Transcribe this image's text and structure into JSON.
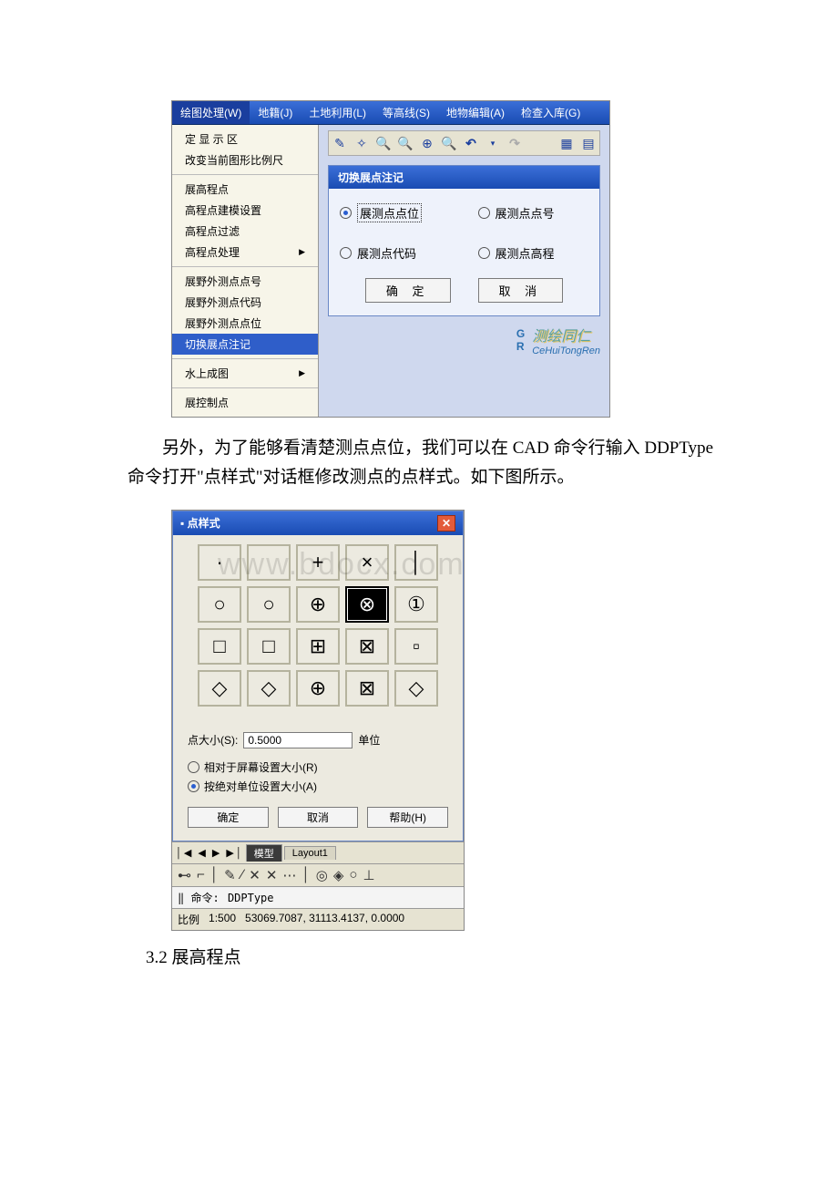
{
  "shot1": {
    "menubar": [
      "绘图处理(W)",
      "地籍(J)",
      "土地利用(L)",
      "等高线(S)",
      "地物编辑(A)",
      "检查入库(G)"
    ],
    "dropGroups": [
      {
        "items": [
          {
            "label": "定 显 示 区",
            "arrow": false
          },
          {
            "label": "改变当前图形比例尺",
            "arrow": false
          }
        ]
      },
      {
        "items": [
          {
            "label": "展高程点",
            "arrow": false
          },
          {
            "label": "高程点建模设置",
            "arrow": false
          },
          {
            "label": "高程点过滤",
            "arrow": false
          },
          {
            "label": "高程点处理",
            "arrow": true
          }
        ]
      },
      {
        "items": [
          {
            "label": "展野外测点点号",
            "arrow": false
          },
          {
            "label": "展野外测点代码",
            "arrow": false
          },
          {
            "label": "展野外测点点位",
            "arrow": false
          },
          {
            "label": "切换展点注记",
            "arrow": false,
            "selected": true
          }
        ]
      },
      {
        "items": [
          {
            "label": "水上成图",
            "arrow": true
          }
        ]
      },
      {
        "items": [
          {
            "label": "展控制点",
            "arrow": false
          }
        ]
      }
    ],
    "toolbarIcons": [
      "pencil-icon",
      "wand-icon",
      "zoom-plus-icon",
      "zoom-icon",
      "zoom-box-icon",
      "zoom-minus-icon",
      "undo-icon",
      "dropdown-icon",
      "redo-icon",
      "palette-icon",
      "grid-icon"
    ],
    "dialog": {
      "title": "切换展点注记",
      "radios": [
        {
          "label": "展测点点位",
          "checked": true,
          "focused": true
        },
        {
          "label": "展测点点号",
          "checked": false
        },
        {
          "label": "展测点代码",
          "checked": false
        },
        {
          "label": "展测点高程",
          "checked": false
        }
      ],
      "ok": "确 定",
      "cancel": "取 消"
    },
    "footerBrand": "测绘同仁",
    "footerSub": "CeHuiTongRen"
  },
  "paragraph1": "另外，为了能够看清楚测点点位，我们可以在 CAD 命令行输入 DDPType 命令打开\"点样式\"对话框修改测点的点样式。如下图所示。",
  "watermark": "www.bdocx.com",
  "shot2": {
    "title": "点样式",
    "styles": [
      "·",
      "",
      "+",
      "×",
      "│",
      "○",
      "○",
      "⊕",
      "⊗",
      "①",
      "□",
      "□",
      "⊞",
      "⊠",
      "▫",
      "◇",
      "◇",
      "⊕",
      "⊠",
      "◇"
    ],
    "selectedIndex": 8,
    "sizeLabel": "点大小(S):",
    "sizeValue": "0.5000",
    "sizeUnit": "单位",
    "radio1": "相对于屏幕设置大小(R)",
    "radio2": "按绝对单位设置大小(A)",
    "radio2Checked": true,
    "btnOk": "确定",
    "btnCancel": "取消",
    "btnHelp": "帮助(H)",
    "tabModel": "模型",
    "tabLayout": "Layout1",
    "cmdLabel": "命令:",
    "cmdValue": "DDPType",
    "statusScaleLabel": "比例",
    "statusScale": "1:500",
    "statusCoords": "53069.7087, 31113.4137, 0.0000"
  },
  "sectionTitle": "3.2 展高程点"
}
